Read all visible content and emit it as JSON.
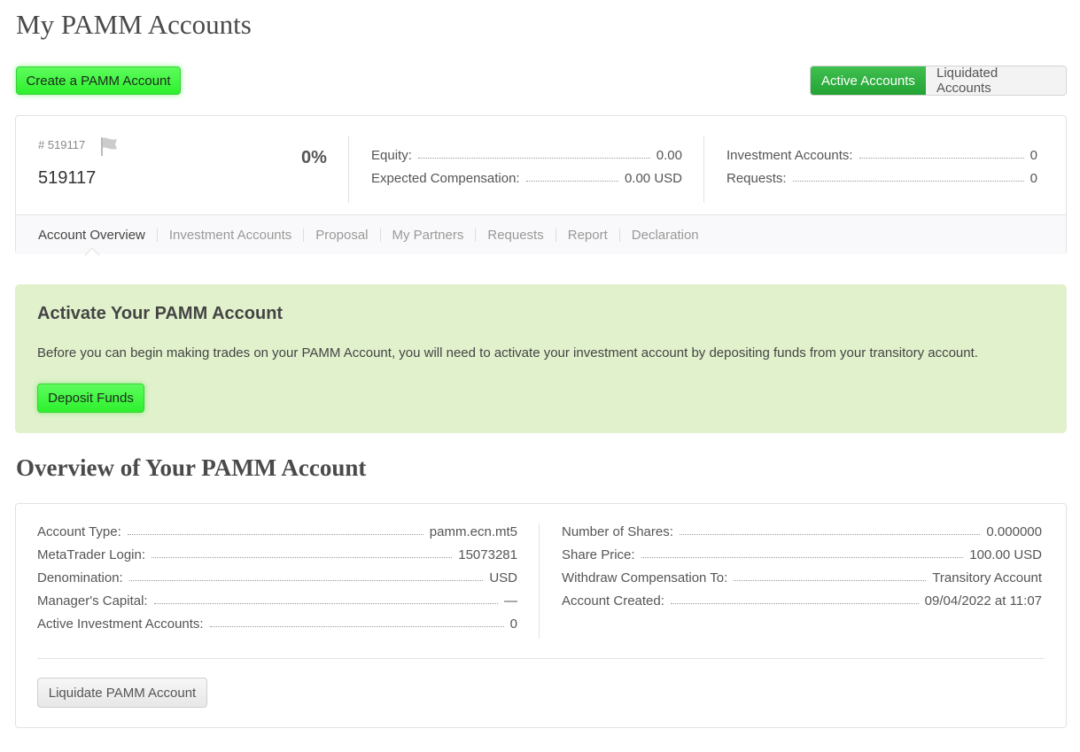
{
  "page": {
    "title": "My PAMM Accounts"
  },
  "toolbar": {
    "create_label": "Create a PAMM Account",
    "active_label": "Active Accounts",
    "liquidated_label": "Liquidated Accounts"
  },
  "account": {
    "id_small": "# 519117",
    "id": "519117",
    "percent": "0%",
    "equity_label": "Equity:",
    "equity_value": "0.00",
    "expected_label": "Expected Compensation:",
    "expected_value": "0.00 USD",
    "inv_accounts_label": "Investment Accounts:",
    "inv_accounts_value": "0",
    "requests_label": "Requests:",
    "requests_value": "0",
    "tabs": [
      "Account Overview",
      "Investment Accounts",
      "Proposal",
      "My Partners",
      "Requests",
      "Report",
      "Declaration"
    ]
  },
  "alert": {
    "title": "Activate Your PAMM Account",
    "text": "Before you can begin making trades on your PAMM Account, you will need to activate your investment account by depositing funds from your transitory account.",
    "button": "Deposit Funds"
  },
  "overview": {
    "title": "Overview of Your PAMM Account",
    "left": [
      {
        "label": "Account Type:",
        "value": "pamm.ecn.mt5"
      },
      {
        "label": "MetaTrader Login:",
        "value": "15073281"
      },
      {
        "label": "Denomination:",
        "value": "USD"
      },
      {
        "label": "Manager's Capital:",
        "value": "—"
      },
      {
        "label": "Active Investment Accounts:",
        "value": "0"
      }
    ],
    "right": [
      {
        "label": "Number of Shares:",
        "value": "0.000000"
      },
      {
        "label": "Share Price:",
        "value": "100.00 USD"
      },
      {
        "label": "Withdraw Compensation To:",
        "value": "Transitory Account"
      },
      {
        "label": "Account Created:",
        "value": "09/04/2022 at 11:07"
      }
    ],
    "liquidate_label": "Liquidate PAMM Account"
  },
  "colors": {
    "green_button": "#2df02d",
    "active_tab": "#22a334",
    "alert_bg": "#e1f1cc"
  },
  "icons": {
    "flag": "flag-icon"
  }
}
